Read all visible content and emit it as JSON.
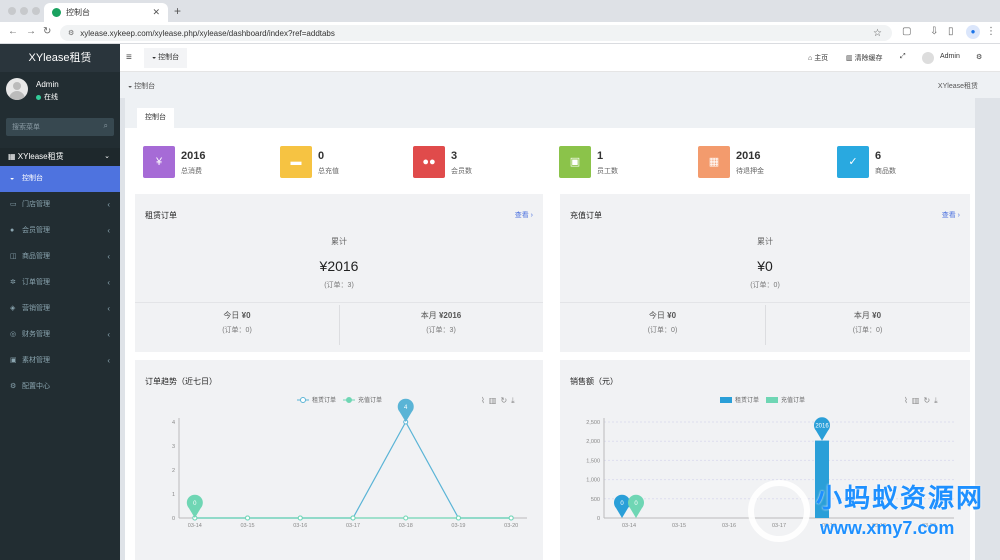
{
  "browser": {
    "tab_title": "控制台",
    "url": "xylease.xykeep.com/xylease.php/xylease/dashboard/index?ref=addtabs",
    "profile_initial": "●"
  },
  "sidebar": {
    "logo": "XYlease租赁",
    "user": {
      "name": "Admin",
      "status": "在线"
    },
    "search_placeholder": "搜索菜单",
    "group": "XYlease租赁",
    "items": [
      {
        "label": "控制台",
        "icon": "dashboard-icon",
        "active": true
      },
      {
        "label": "门店管理",
        "icon": "store-icon"
      },
      {
        "label": "会员管理",
        "icon": "user-icon"
      },
      {
        "label": "商品管理",
        "icon": "goods-icon"
      },
      {
        "label": "订单管理",
        "icon": "order-icon"
      },
      {
        "label": "营销管理",
        "icon": "marketing-icon"
      },
      {
        "label": "财务管理",
        "icon": "finance-icon"
      },
      {
        "label": "素材管理",
        "icon": "media-icon"
      },
      {
        "label": "配置中心",
        "icon": "gear-icon"
      }
    ]
  },
  "header": {
    "nav_tab": "控制台",
    "home": "主页",
    "clear_cache": "清除缓存",
    "admin": "Admin"
  },
  "breadcrumb": {
    "left": "控制台",
    "right": "XYlease租赁"
  },
  "panel_tab": "控制台",
  "stats": [
    {
      "value": "2016",
      "label": "总消费",
      "color": "#a66bd6",
      "icon": "yen-icon",
      "glyph": "¥"
    },
    {
      "value": "0",
      "label": "总充值",
      "color": "#f6c342",
      "icon": "wallet-icon",
      "glyph": "▬"
    },
    {
      "value": "3",
      "label": "会员数",
      "color": "#e04b4b",
      "icon": "users-icon",
      "glyph": "●●"
    },
    {
      "value": "1",
      "label": "员工数",
      "color": "#8bc34a",
      "icon": "badge-icon",
      "glyph": "▣"
    },
    {
      "value": "2016",
      "label": "待退押金",
      "color": "#f39b6d",
      "icon": "grid-icon",
      "glyph": "▦"
    },
    {
      "value": "6",
      "label": "商品数",
      "color": "#29a9e0",
      "icon": "check-icon",
      "glyph": "✓"
    }
  ],
  "rent_card": {
    "title": "租赁订单",
    "more": "查看 ›",
    "total_label": "累计",
    "total_value": "¥2016",
    "total_orders": "(订单：3)",
    "today_label": "今日",
    "today_value": "¥0",
    "today_orders": "(订单：0)",
    "month_label": "本月",
    "month_value": "¥2016",
    "month_orders": "(订单：3)"
  },
  "recharge_card": {
    "title": "充值订单",
    "more": "查看 ›",
    "total_label": "累计",
    "total_value": "¥0",
    "total_orders": "(订单：0)",
    "today_label": "今日",
    "today_value": "¥0",
    "today_orders": "(订单：0)",
    "month_label": "本月",
    "month_value": "¥0",
    "month_orders": "(订单：0)"
  },
  "trend_card": {
    "title": "订单趋势（近七日）"
  },
  "sales_card": {
    "title": "销售额（元）"
  },
  "chart_data": [
    {
      "type": "line",
      "title": "订单趋势（近七日）",
      "categories": [
        "03-14",
        "03-15",
        "03-16",
        "03-17",
        "03-18",
        "03-19",
        "03-20"
      ],
      "series": [
        {
          "name": "租赁订单",
          "values": [
            0,
            0,
            0,
            0,
            4,
            0,
            0
          ],
          "color": "#5ab4d6"
        },
        {
          "name": "充值订单",
          "values": [
            0,
            0,
            0,
            0,
            0,
            0,
            0
          ],
          "color": "#6fd6b4"
        }
      ],
      "ylim": [
        0,
        4
      ],
      "yticks": [
        "0",
        "1",
        "2",
        "3",
        "4"
      ],
      "legend": "top-center",
      "pins": [
        {
          "category": "03-14",
          "value": 0,
          "series": "充值订单",
          "label": "0"
        },
        {
          "category": "03-18",
          "value": 4,
          "series": "租赁订单",
          "label": "4"
        }
      ]
    },
    {
      "type": "bar",
      "title": "销售额（元）",
      "categories": [
        "03-14",
        "03-15",
        "03-16",
        "03-17",
        "03-18",
        "03-19",
        "03-20"
      ],
      "series": [
        {
          "name": "租赁订单",
          "values": [
            0,
            0,
            0,
            0,
            2016,
            0,
            0
          ],
          "color": "#2a9fd8"
        },
        {
          "name": "充值订单",
          "values": [
            0,
            0,
            0,
            0,
            0,
            0,
            0
          ],
          "color": "#6fd6b4"
        }
      ],
      "ylim": [
        0,
        2500
      ],
      "yticks": [
        "0",
        "500",
        "1,000",
        "1,500",
        "2,000",
        "2,500"
      ],
      "legend": "top-center",
      "pins": [
        {
          "category": "03-14",
          "value": 0,
          "series": "租赁订单",
          "label": "0"
        },
        {
          "category": "03-14",
          "value": 0,
          "series": "充值订单",
          "label": "0"
        },
        {
          "category": "03-18",
          "value": 2016,
          "series": "租赁订单",
          "label": "2016"
        }
      ]
    }
  ]
}
